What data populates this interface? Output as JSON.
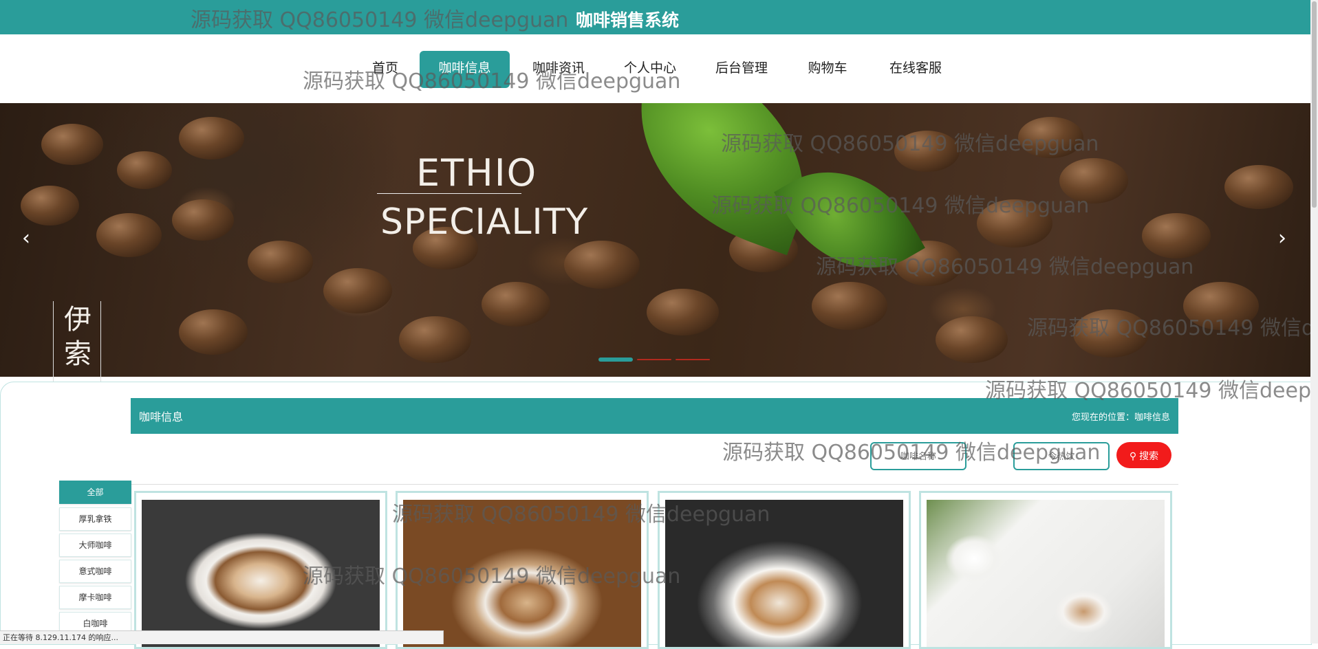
{
  "header": {
    "title": "咖啡销售系统"
  },
  "nav": {
    "items": [
      "首页",
      "咖啡信息",
      "咖啡资讯",
      "个人中心",
      "后台管理",
      "购物车",
      "在线客服"
    ]
  },
  "banner": {
    "line1": "ETHIO",
    "line2": "SPECIALITY",
    "vertical": "伊索",
    "prev": "‹",
    "next": "›"
  },
  "section": {
    "title": "咖啡信息",
    "location": "您现在的位置：咖啡信息"
  },
  "search": {
    "name_placeholder": "咖啡名称",
    "hot_placeholder": "今热饮",
    "button": "搜索"
  },
  "categories": [
    "全部",
    "厚乳拿铁",
    "大师咖啡",
    "意式咖啡",
    "摩卡咖啡",
    "白咖啡"
  ],
  "watermark": "源码获取 QQ86050149 微信deepguan",
  "status": "正在等待 8.129.11.174 的响应..."
}
